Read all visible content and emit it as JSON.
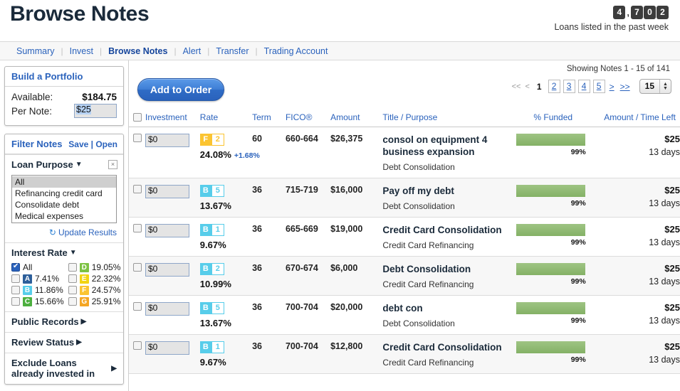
{
  "header": {
    "title": "Browse Notes",
    "counter_digits": [
      "4",
      ",",
      "7",
      "0",
      "2"
    ],
    "counter_caption": "Loans listed in the past week"
  },
  "nav": {
    "items": [
      {
        "label": "Summary",
        "active": false
      },
      {
        "label": "Invest",
        "active": false
      },
      {
        "label": "Browse Notes",
        "active": true
      },
      {
        "label": "Alert",
        "active": false
      },
      {
        "label": "Transfer",
        "active": false
      },
      {
        "label": "Trading Account",
        "active": false
      }
    ]
  },
  "sidebar": {
    "portfolio": {
      "heading": "Build a Portfolio",
      "available_label": "Available:",
      "available_value": "$184.75",
      "per_note_label": "Per Note:",
      "per_note_value": "$25"
    },
    "filter": {
      "heading": "Filter Notes",
      "save_open": "Save | Open",
      "loan_purpose": {
        "title": "Loan Purpose",
        "close_icon": "close-icon",
        "options": [
          "All",
          "Refinancing credit card",
          "Consolidate debt",
          "Medical expenses"
        ],
        "selected": "All",
        "update_label": "Update Results"
      },
      "interest_rate": {
        "title": "Interest Rate",
        "items": [
          {
            "grade": "",
            "label": "All",
            "checked": true,
            "color": ""
          },
          {
            "grade": "D",
            "label": "19.05%",
            "checked": false,
            "color": "#7dc243"
          },
          {
            "grade": "A",
            "label": "7.41%",
            "checked": false,
            "color": "#2d5f9a"
          },
          {
            "grade": "E",
            "label": "22.32%",
            "checked": false,
            "color": "#f2d413"
          },
          {
            "grade": "B",
            "label": "11.86%",
            "checked": false,
            "color": "#57cdea"
          },
          {
            "grade": "F",
            "label": "24.57%",
            "checked": false,
            "color": "#fbc431"
          },
          {
            "grade": "C",
            "label": "15.66%",
            "checked": false,
            "color": "#4caf3f"
          },
          {
            "grade": "G",
            "label": "25.91%",
            "checked": false,
            "color": "#f5a623"
          }
        ]
      },
      "sections": [
        {
          "title": "Public Records"
        },
        {
          "title": "Review Status"
        },
        {
          "title": "Exclude Loans already invested in"
        }
      ]
    }
  },
  "main": {
    "add_to_order_label": "Add to Order",
    "showing_text": "Showing Notes 1 - 15 of 141",
    "pager": {
      "first": "<<",
      "prev": "<",
      "current": "1",
      "pages": [
        "2",
        "3",
        "4",
        "5"
      ],
      "next": ">",
      "last": ">>",
      "per_page": "15"
    },
    "columns": [
      "Investment",
      "Rate",
      "Term",
      "FICO®",
      "Amount",
      "Title / Purpose",
      "% Funded",
      "Amount / Time Left"
    ],
    "rows": [
      {
        "investment": "$0",
        "grade_letter": "F",
        "grade_num": "2",
        "grade_color": "#fbc431",
        "rate": "24.08%",
        "rate_delta": "+1.68%",
        "term": "60",
        "fico": "660-664",
        "amount": "$26,375",
        "title": "consol on equipment 4 business expansion",
        "purpose": "Debt Consolidation",
        "funded_pct": "99%",
        "funded_value": 99,
        "amt_left": "$25",
        "time_left": "13 days"
      },
      {
        "investment": "$0",
        "grade_letter": "B",
        "grade_num": "5",
        "grade_color": "#57cdea",
        "rate": "13.67%",
        "rate_delta": "",
        "term": "36",
        "fico": "715-719",
        "amount": "$16,000",
        "title": "Pay off my debt",
        "purpose": "Debt Consolidation",
        "funded_pct": "99%",
        "funded_value": 99,
        "amt_left": "$25",
        "time_left": "13 days"
      },
      {
        "investment": "$0",
        "grade_letter": "B",
        "grade_num": "1",
        "grade_color": "#57cdea",
        "rate": "9.67%",
        "rate_delta": "",
        "term": "36",
        "fico": "665-669",
        "amount": "$19,000",
        "title": "Credit Card Consolidation",
        "purpose": "Credit Card Refinancing",
        "funded_pct": "99%",
        "funded_value": 99,
        "amt_left": "$25",
        "time_left": "13 days"
      },
      {
        "investment": "$0",
        "grade_letter": "B",
        "grade_num": "2",
        "grade_color": "#57cdea",
        "rate": "10.99%",
        "rate_delta": "",
        "term": "36",
        "fico": "670-674",
        "amount": "$6,000",
        "title": "Debt Consolidation",
        "purpose": "Credit Card Refinancing",
        "funded_pct": "99%",
        "funded_value": 99,
        "amt_left": "$25",
        "time_left": "13 days"
      },
      {
        "investment": "$0",
        "grade_letter": "B",
        "grade_num": "5",
        "grade_color": "#57cdea",
        "rate": "13.67%",
        "rate_delta": "",
        "term": "36",
        "fico": "700-704",
        "amount": "$20,000",
        "title": "debt con",
        "purpose": "Debt Consolidation",
        "funded_pct": "99%",
        "funded_value": 99,
        "amt_left": "$25",
        "time_left": "13 days"
      },
      {
        "investment": "$0",
        "grade_letter": "B",
        "grade_num": "1",
        "grade_color": "#57cdea",
        "rate": "9.67%",
        "rate_delta": "",
        "term": "36",
        "fico": "700-704",
        "amount": "$12,800",
        "title": "Credit Card Consolidation",
        "purpose": "Credit Card Refinancing",
        "funded_pct": "99%",
        "funded_value": 99,
        "amt_left": "$25",
        "time_left": "13 days"
      }
    ]
  },
  "colors": {
    "link": "#2a62bc",
    "bar_green": "#8fbb6f",
    "title_dark": "#1a2a3a"
  }
}
